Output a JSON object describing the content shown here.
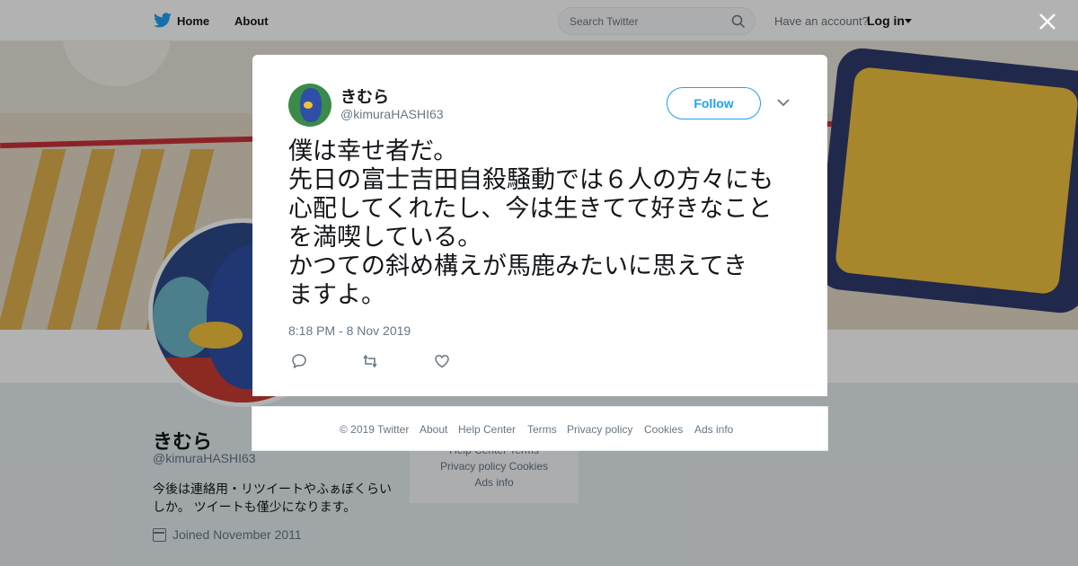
{
  "topnav": {
    "home_label": "Home",
    "about_label": "About",
    "search_placeholder": "Search Twitter",
    "account_prompt": "Have an account?",
    "login_label": "Log in"
  },
  "profile": {
    "name": "きむら",
    "handle": "@kimuraHASHI63",
    "bio": "今後は連絡用・リツイートやふぁぼくらいしか。 ツイートも僅少になります。",
    "joined": "Joined November 2011"
  },
  "side_footer": {
    "row1": "Help Center   Terms",
    "row2": "Privacy policy   Cookies",
    "row3": "Ads info"
  },
  "tweet": {
    "author_name": "きむら",
    "author_handle": "@kimuraHASHI63",
    "follow_label": "Follow",
    "text_lines": [
      "僕は幸せ者だ。",
      "先日の富士吉田自殺騒動では６人の方々にも",
      "心配してくれたし、今は生きてて好きなこと",
      "を満喫している。",
      "かつての斜め構えが馬鹿みたいに思えてき",
      "ますよ。"
    ],
    "timestamp": "8:18 PM - 8 Nov 2019"
  },
  "footer": {
    "copyright": "© 2019 Twitter",
    "about": "About",
    "help": "Help Center",
    "terms": "Terms",
    "privacy": "Privacy policy",
    "cookies": "Cookies",
    "ads": "Ads info"
  },
  "icons": {
    "logo": "twitter-bird-icon",
    "search": "search-icon",
    "close": "close-icon",
    "chevron": "chevron-down-icon",
    "reply": "reply-icon",
    "retweet": "retweet-icon",
    "like": "heart-icon",
    "calendar": "calendar-icon"
  },
  "colors": {
    "brand": "#1da1f2",
    "text": "#14171a",
    "muted": "#657786"
  }
}
